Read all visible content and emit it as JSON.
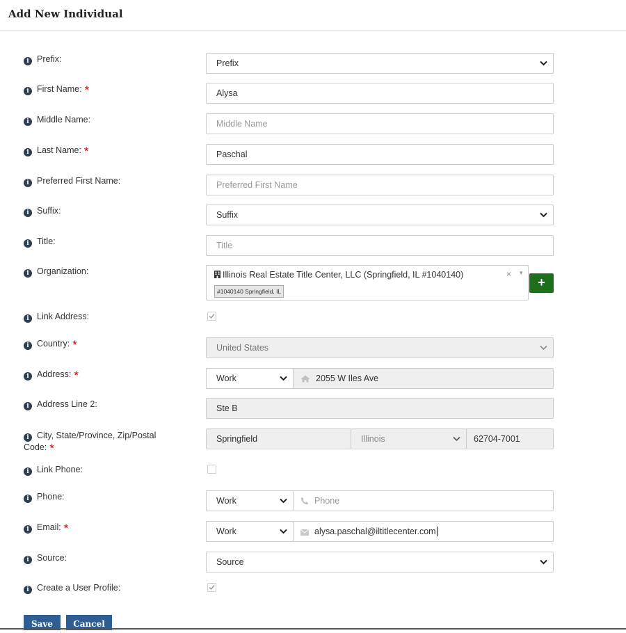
{
  "header": {
    "title": "Add New Individual"
  },
  "labels": {
    "prefix": "Prefix:",
    "first_name": "First Name:",
    "middle_name": "Middle Name:",
    "last_name": "Last Name:",
    "preferred_first_name": "Preferred First Name:",
    "suffix": "Suffix:",
    "title": "Title:",
    "organization": "Organization:",
    "link_address": "Link Address:",
    "country": "Country:",
    "address": "Address:",
    "address_line2": "Address Line 2:",
    "city_state_zip_line1": "City, State/Province, Zip/Postal",
    "city_state_zip_line2": "Code:",
    "link_phone": "Link Phone:",
    "phone": "Phone:",
    "email": "Email:",
    "source": "Source:",
    "create_user_profile": "Create a User Profile:"
  },
  "required_marker": "*",
  "info_icon_glyph": "i",
  "fields": {
    "prefix": {
      "value": "Prefix"
    },
    "first_name": {
      "value": "Alysa"
    },
    "middle_name": {
      "placeholder": "Middle Name"
    },
    "last_name": {
      "value": "Paschal"
    },
    "preferred_first_name": {
      "placeholder": "Preferred First Name"
    },
    "suffix": {
      "value": "Suffix"
    },
    "title": {
      "placeholder": "Title"
    },
    "organization": {
      "value": "Illinois Real Estate Title Center, LLC (Springfield, IL #1040140)",
      "tag": "#1040140 Springfield, IL",
      "clear": "×",
      "caret": "▾",
      "add_button": "+"
    },
    "link_address": {
      "checked": true
    },
    "country": {
      "value": "United States"
    },
    "address": {
      "type": "Work",
      "value": "2055 W Iles Ave"
    },
    "address_line2": {
      "value": "Ste B"
    },
    "city": {
      "value": "Springfield"
    },
    "state": {
      "value": "Illinois"
    },
    "zip": {
      "value": "62704-7001"
    },
    "link_phone": {
      "checked": false
    },
    "phone": {
      "type": "Work",
      "placeholder": "Phone"
    },
    "email": {
      "type": "Work",
      "value": "alysa.paschal@iltitlecenter.com"
    },
    "source": {
      "value": "Source"
    },
    "create_user_profile": {
      "checked": true
    }
  },
  "buttons": {
    "save": "Save",
    "cancel": "Cancel"
  },
  "colors": {
    "required": "#d40000",
    "primary_button": "#2d5f95",
    "add_button": "#1e6e1e",
    "info_icon": "#2c3e50"
  },
  "icons": {
    "organization": "building-icon",
    "address": "home-icon",
    "phone": "phone-icon",
    "email": "envelope-icon",
    "info": "info-circle-icon",
    "select": "chevron-down-icon"
  }
}
